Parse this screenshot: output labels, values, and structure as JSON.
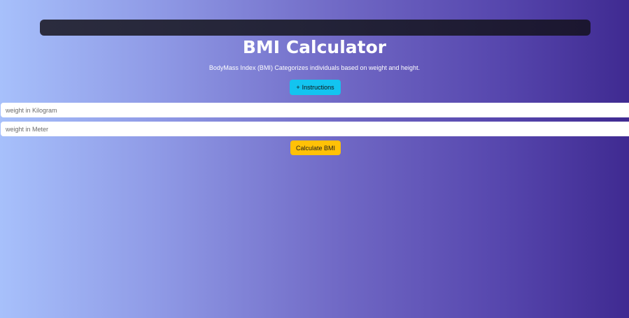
{
  "header": {
    "title": "BMI Calculator",
    "subtitle": "BodyMass Index (BMI) Categorizes individuals based on weight and height."
  },
  "instructions_button": {
    "icon": "plus-icon",
    "icon_glyph": "+",
    "label": "Instructions"
  },
  "form": {
    "weight_placeholder": "weight in Kilogram",
    "weight_value": "",
    "height_placeholder": "weight in Meter",
    "height_value": "",
    "calculate_label": "Calculate BMI"
  },
  "colors": {
    "instructions_button": "#13c4f0",
    "calculate_button": "#ffc107",
    "top_bar": "#232338"
  }
}
